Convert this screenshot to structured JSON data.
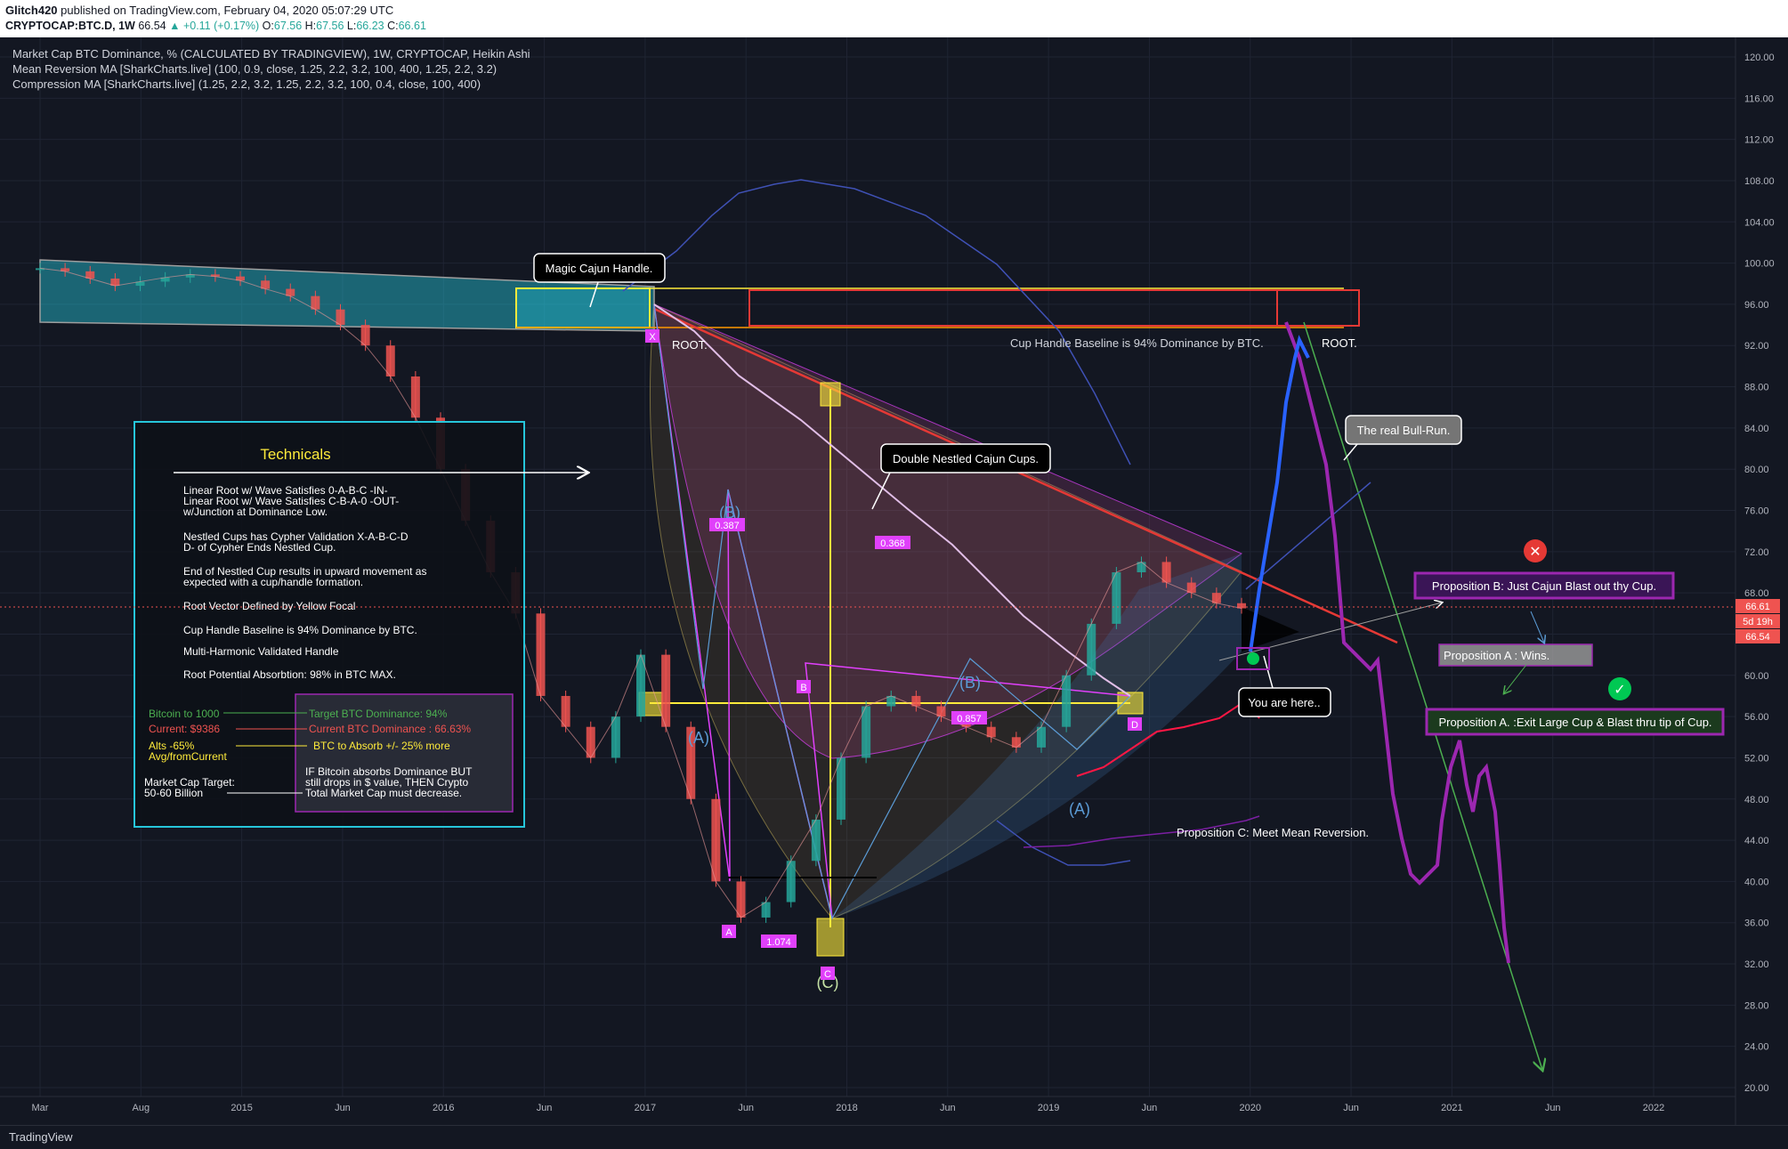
{
  "header": {
    "author": "Glitch420",
    "published": "published on TradingView.com, February 04, 2020 05:07:29 UTC",
    "symbol": "CRYPTOCAP:BTC.D, 1W",
    "last": "66.54",
    "change": "▲ +0.11 (+0.17%)",
    "o_label": "O:",
    "o": "67.56",
    "h_label": "H:",
    "h": "67.56",
    "l_label": "L:",
    "l": "66.23",
    "c_label": "C:",
    "c": "66.61"
  },
  "legend": {
    "line1": "Market Cap BTC Dominance, % (CALCULATED BY TRADINGVIEW), 1W, CRYPTOCAP, Heikin Ashi",
    "line2": "Mean Reversion MA [SharkCharts.live] (100, 0.9, close, 1.25, 2.2, 3.2, 100, 400, 1.25, 2.2, 3.2)",
    "line3": "Compression MA [SharkCharts.live] (1.25, 2.2, 3.2, 1.25, 2.2, 3.2, 100, 0.4, close, 100, 400)"
  },
  "footer": {
    "brand": "TradingView"
  },
  "colors": {
    "background": "#131722",
    "up": "#26a69a",
    "down": "#ef5350",
    "accent_purple": "#9c27b0",
    "accent_yellow": "#ffeb3b"
  },
  "chart_data": {
    "type": "line",
    "yaxis": {
      "ticks": [
        "120.00",
        "116.00",
        "112.00",
        "108.00",
        "104.00",
        "100.00",
        "96.00",
        "92.00",
        "88.00",
        "84.00",
        "80.00",
        "76.00",
        "72.00",
        "68.00",
        "64.00",
        "60.00",
        "56.00",
        "52.00",
        "48.00",
        "44.00",
        "40.00",
        "36.00",
        "32.00",
        "28.00",
        "24.00",
        "20.00"
      ],
      "ylim": [
        20,
        120
      ]
    },
    "xaxis": {
      "ticks": [
        "Mar",
        "Aug",
        "2015",
        "Jun",
        "2016",
        "Jun",
        "2017",
        "Jun",
        "2018",
        "Jun",
        "2019",
        "Jun",
        "2020",
        "Jun",
        "2021",
        "Jun",
        "2022"
      ]
    },
    "price_badges": [
      "66.61",
      "5d 19h",
      "66.54"
    ],
    "series": [
      {
        "values": [
          99.5,
          99.2,
          98.5,
          97.8,
          98.2,
          98.6,
          98.9,
          98.7,
          98.3,
          97.5,
          96.8,
          95.5,
          94.0,
          92.0,
          89.0,
          85.0,
          80.0,
          75.0,
          70.0,
          66.0,
          58.0,
          55.0,
          52.0,
          56.0,
          62.0,
          55.0,
          48.0,
          40.0,
          36.5,
          38.0,
          42.0,
          46.0,
          52.0,
          57.0,
          58.0,
          57.0,
          56.0,
          55.0,
          54.0,
          53.0,
          55.0,
          60.0,
          65.0,
          70.0,
          71.0,
          69.0,
          68.0,
          67.0,
          66.5
        ]
      }
    ],
    "annotations": {
      "magic_handle": "Magic Cajun Handle.",
      "double_cups": "Double Nestled Cajun Cups.",
      "root_left": "ROOT.",
      "root_right": "ROOT.",
      "baseline": "Cup Handle Baseline is 94% Dominance by BTC.",
      "bull_run": "The real Bull-Run.",
      "you_are_here": "You are here..",
      "prop_b": "Proposition B: Just Cajun Blast out thy Cup.",
      "prop_a_wins": "Proposition A : Wins.",
      "prop_a": "Proposition A. :Exit Large Cup & Blast thru tip of Cup.",
      "prop_c": "Proposition C: Meet Mean Reversion.",
      "wave_b1": "(B)",
      "wave_a1": "(A)",
      "wave_c": "(C)",
      "wave_b2": "(B)",
      "wave_a2": "(A)",
      "ratio1": "0.387",
      "ratio2": "0.368",
      "ratio3": "0.857",
      "ratio4": "1.074",
      "pt_a": "A",
      "pt_b": "B",
      "pt_c": "C",
      "pt_d": "D",
      "pt_x": "X"
    },
    "technicals": {
      "title": "Technicals",
      "p1": "Linear Root w/ Wave Satisfies 0-A-B-C -IN-",
      "p1b": "Linear Root w/ Wave Satisfies C-B-A-0 -OUT-",
      "p1c": "w/Junction at Dominance Low.",
      "p2": "Nestled Cups has Cypher Validation X-A-B-C-D",
      "p2b": "D- of Cypher Ends Nestled Cup.",
      "p3": "End of Nestled Cup results in upward movement as",
      "p3b": "expected with a cup/handle formation.",
      "p4": "Root Vector Defined by Yellow Focal",
      "p5": "Cup Handle Baseline is 94% Dominance by BTC.",
      "p6": "Multi-Harmonic Validated Handle",
      "p7": "Root Potential Absorbtion: 98% in BTC MAX.",
      "btc_1000": "Bitcoin to 1000",
      "current_price": "Current: $9386",
      "alts": "Alts -65%",
      "avg": "Avg/fromCurrent",
      "mcap": "Market Cap Target:",
      "mcap_val": "50-60 Billion",
      "target_dom": "Target BTC Dominance: 94%",
      "current_dom": "Current BTC Dominance : 66.63%",
      "absorb": "BTC to Absorb +/- 25% more",
      "if1": "IF Bitcoin absorbs Dominance BUT",
      "if2": "still drops in $ value, THEN Crypto",
      "if3": "Total Market Cap must decrease."
    }
  }
}
